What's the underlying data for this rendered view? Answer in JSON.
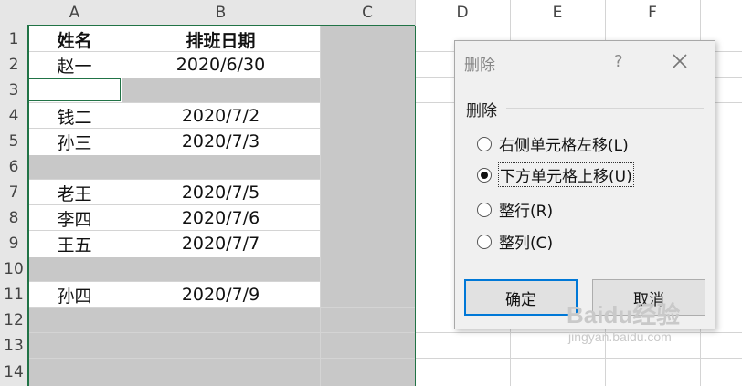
{
  "columns": [
    "A",
    "B",
    "C",
    "D",
    "E",
    "F"
  ],
  "rows": [
    "1",
    "2",
    "3",
    "4",
    "5",
    "6",
    "7",
    "8",
    "9",
    "10",
    "11",
    "12",
    "13",
    "14"
  ],
  "sheet": {
    "header_name": "姓名",
    "header_date": "排班日期",
    "r2_name": "赵一",
    "r2_date": "2020/6/30",
    "r4_name": "钱二",
    "r4_date": "2020/7/2",
    "r5_name": "孙三",
    "r5_date": "2020/7/3",
    "r7_name": "老王",
    "r7_date": "2020/7/5",
    "r8_name": "李四",
    "r8_date": "2020/7/6",
    "r9_name": "王五",
    "r9_date": "2020/7/7",
    "r11_name": "孙四",
    "r11_date": "2020/7/9"
  },
  "dialog": {
    "title": "删除",
    "help": "?",
    "group_label": "删除",
    "options": [
      "右侧单元格左移(L)",
      "下方单元格上移(U)",
      "整行(R)",
      "整列(C)"
    ],
    "selected_index": 1,
    "ok_label": "确定",
    "cancel_label": "取消"
  },
  "watermark": {
    "brand": "Baidu经验",
    "url": "jingyan.baidu.com"
  },
  "colors": {
    "selection_green": "#217346",
    "cell_gray": "#c8c8c8",
    "header_gray": "#e6e6e6",
    "dialog_bg": "#f0f0f0",
    "focus_blue": "#0078d7"
  }
}
